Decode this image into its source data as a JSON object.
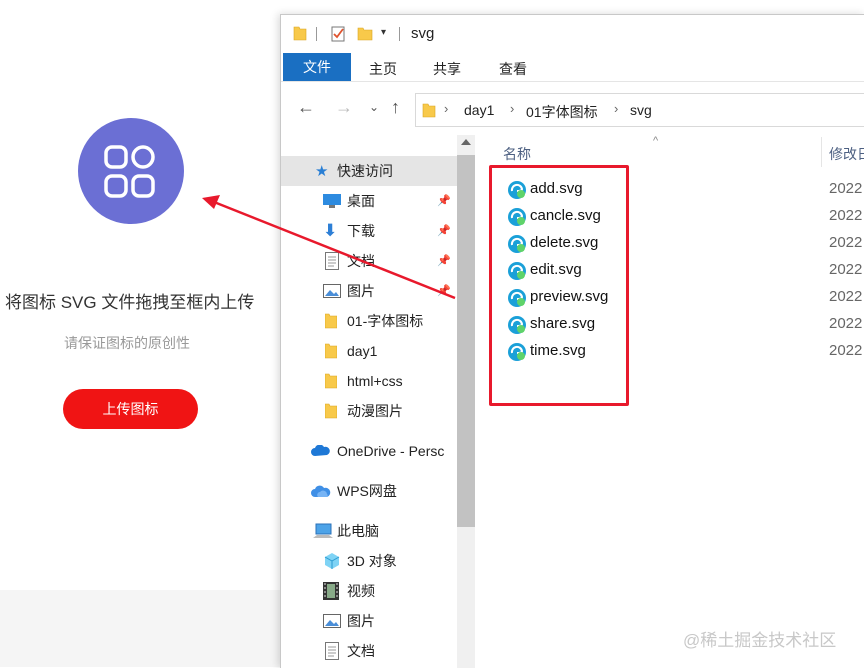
{
  "upload": {
    "title": "将图标 SVG 文件拖拽至框内上传",
    "subtitle": "请保证图标的原创性",
    "button_label": "上传图标",
    "icon": "apps-grid-icon",
    "accent_color": "#6b6fd4",
    "button_color": "#f01414"
  },
  "explorer": {
    "window_title": "svg",
    "ribbon": {
      "file_tab": "文件",
      "tabs": [
        "主页",
        "共享",
        "查看"
      ]
    },
    "breadcrumb": [
      "day1",
      "01字体图标",
      "svg"
    ],
    "nav": {
      "quick_access": "快速访问",
      "pinned": [
        "桌面",
        "下载",
        "文档",
        "图片"
      ],
      "folders": [
        "01-字体图标",
        "day1",
        "html+css",
        "动漫图片"
      ],
      "onedrive": "OneDrive - Persc",
      "wps": "WPS网盘",
      "this_pc": "此电脑",
      "pc_items": [
        "3D 对象",
        "视频",
        "图片",
        "文档"
      ]
    },
    "columns": {
      "name": "名称",
      "date": "修改日"
    },
    "files": [
      {
        "name": "add.svg",
        "date": "2022"
      },
      {
        "name": "cancle.svg",
        "date": "2022"
      },
      {
        "name": "delete.svg",
        "date": "2022"
      },
      {
        "name": "edit.svg",
        "date": "2022"
      },
      {
        "name": "preview.svg",
        "date": "2022"
      },
      {
        "name": "share.svg",
        "date": "2022"
      },
      {
        "name": "time.svg",
        "date": "2022"
      }
    ]
  },
  "watermark": "@稀土掘金技术社区",
  "annotation_color": "#e8192c"
}
